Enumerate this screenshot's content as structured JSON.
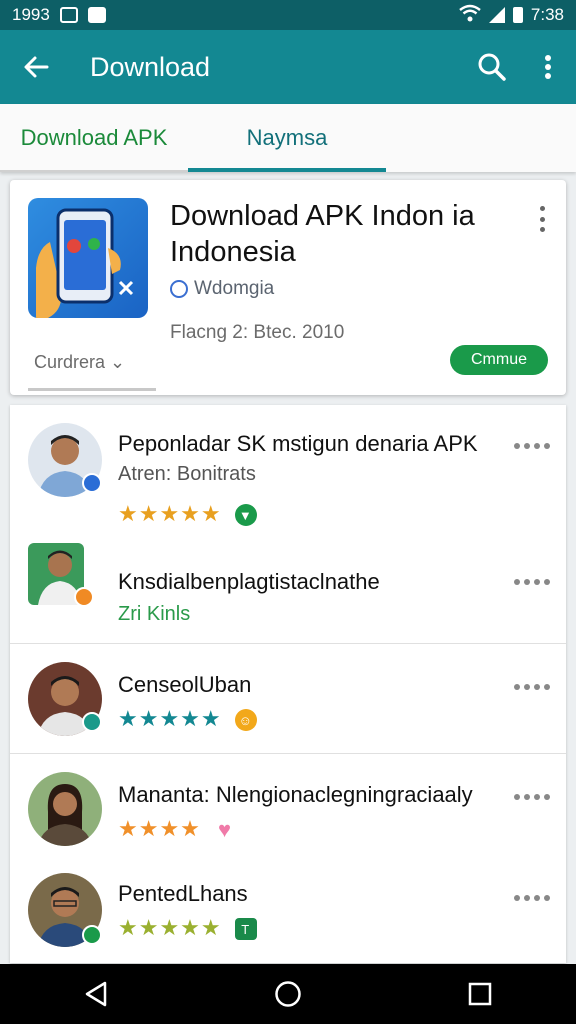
{
  "status_bar": {
    "time_left": "1993",
    "time_right": "7:38"
  },
  "app_bar": {
    "title": "Download"
  },
  "tabs": [
    {
      "label": "Download APK"
    },
    {
      "label": "Naymsa"
    }
  ],
  "app_card": {
    "title_line1": "Download APK Indon ia",
    "title_line2": "Indonesia",
    "developer": "Wdomgia",
    "meta": "Flacng 2: Btec. 2010",
    "category": "Curdrera",
    "continue_label": "Cmmue"
  },
  "reviews": [
    {
      "name": "Peponladar SK  mstigun denaria APK",
      "sub": "Atren: Bonitrats",
      "stars": "★★★★★",
      "sub_color": "gray"
    },
    {
      "name": "Knsdialbenplagtistaclnathe",
      "sub": "Zri Kinls",
      "stars": "",
      "sub_color": "green"
    },
    {
      "name": "CenseolUban",
      "sub": "",
      "stars": "★★★★★",
      "sub_color": "gray"
    },
    {
      "name": "Mananta: Nlengionaclegningraciaaly",
      "sub": "",
      "stars": "★★★★",
      "sub_color": "gray"
    },
    {
      "name": "PentedLhans",
      "sub": "",
      "stars": "★★★★★",
      "sub_color": "gray"
    }
  ],
  "colors": {
    "status_bar": "#0d5f66",
    "app_bar": "#138892",
    "tab_active": "#12707a",
    "tab_inactive": "#1b8a3a",
    "continue_button": "#1a9a4a"
  },
  "icons": {
    "app_bar": [
      "back-arrow-icon",
      "search-icon",
      "more-vert-icon"
    ],
    "navigation": [
      "back-triangle-icon",
      "home-circle-icon",
      "recents-square-icon"
    ]
  }
}
